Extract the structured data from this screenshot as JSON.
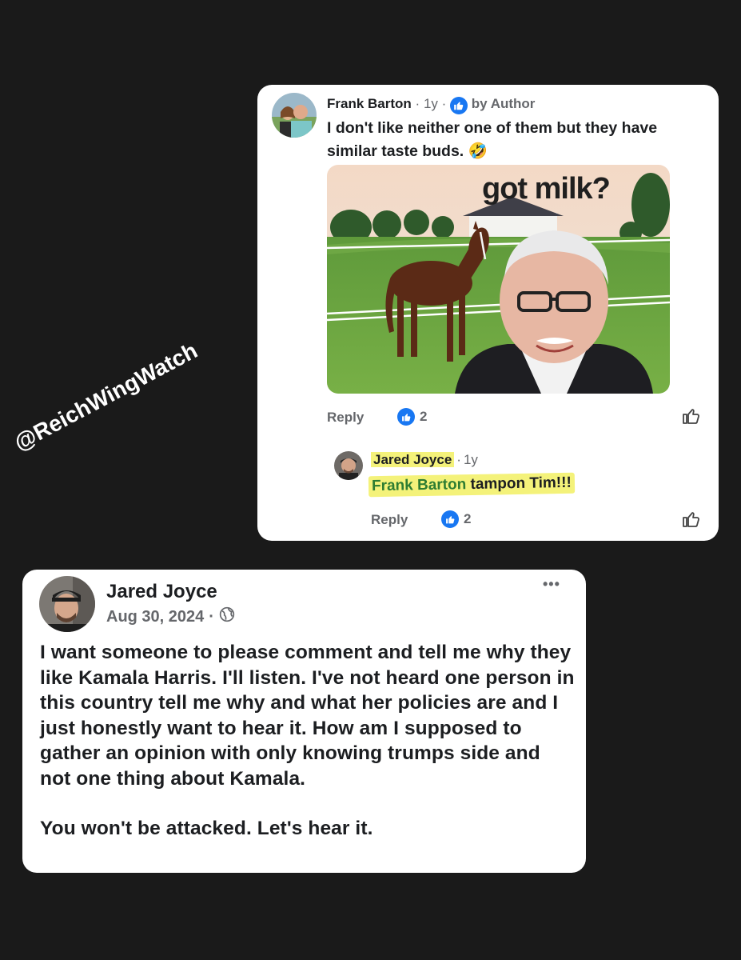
{
  "watermark": "@ReichWingWatch",
  "comment": {
    "author": "Frank Barton",
    "separator1": "·",
    "time": "1y",
    "separator2": "·",
    "author_badge": "by Author",
    "text": "I don't like neither one of them but they have similar taste buds. 🤣",
    "meme_caption": "got milk?",
    "reply_label": "Reply",
    "like_count": "2"
  },
  "reply": {
    "author": "Jared Joyce",
    "separator": "·",
    "time": "1y",
    "mention": "Frank Barton",
    "text": "tampon Tim!!!",
    "reply_label": "Reply",
    "like_count": "2"
  },
  "post": {
    "author": "Jared Joyce",
    "date": "Aug 30, 2024",
    "separator": "·",
    "more_label": "•••",
    "paragraph1": "I want someone to please comment and tell me why they like Kamala Harris. I'll listen.  I've not heard one person in this country tell me why and what her policies are and I just honestly want to hear it. How am I supposed to gather an opinion with only knowing trumps side and not one thing about Kamala.",
    "paragraph2": "You won't be attacked. Let's hear it."
  },
  "colors": {
    "background": "#1a1a1a",
    "card": "#ffffff",
    "facebook_blue": "#1877f2",
    "highlight": "#f4f27a",
    "text": "#1c1e21",
    "muted": "#65676b",
    "mention_green": "#2e7d32"
  },
  "icons": [
    "like-icon",
    "globe-icon",
    "more-options-icon",
    "thumbs-up-outline-icon"
  ]
}
